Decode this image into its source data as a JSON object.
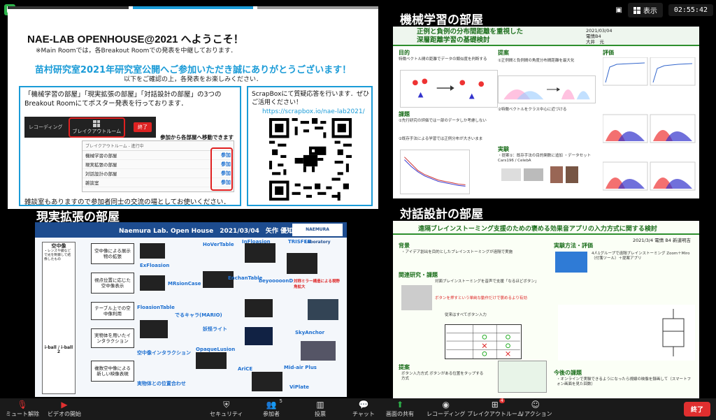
{
  "overlay": {
    "view_label": "表示",
    "clock": "02:55:42"
  },
  "main_slide": {
    "title": "NAE-LAB OPENHOUSE@2021 へようこそ！",
    "note": "※Main Roomでは，各Breakout Roomでの発表を中継しております．",
    "thanks": "苗村研究室2021年研究室公開へご参加いただき誠にありがとうございます！",
    "sub": "以下をご確認の上，各発表をお楽しみください．",
    "left_box_text": "「機械学習の部屋」「現実拡張の部屋」「対話設計の部屋」の3つのBreakout Roomにてポスター発表を行っております．",
    "zoom_recording": "レコーディング",
    "zoom_breakout": "ブレイクアウトルーム",
    "zoom_end": "終了",
    "join_caption": "参加から各部屋へ移動できます",
    "bo_panel_header": "ブレイクアウトルーム - 進行中",
    "rooms": [
      {
        "name": "機械学習の部屋",
        "join": "参加"
      },
      {
        "name": "現実拡張の部屋",
        "join": "参加"
      },
      {
        "name": "対話設計の部屋",
        "join": "参加"
      },
      {
        "name": "雑談室",
        "join": "参加"
      }
    ],
    "left_box_bottom": "雑談室もありますので参加者同士の交流の場としてお使いください．",
    "right_box_text": "ScrapBoxにて質疑応答を行います．ぜひご活用ください！",
    "url": "https://scrapbox.io/nae-lab2021/",
    "bar_colors": [
      "#333333",
      "#1a9bd7",
      "#999999"
    ]
  },
  "tiles": {
    "ml_label": "機械学習の部屋",
    "ar_label": "現実拡張の部屋",
    "dd_label": "対話設計の部屋"
  },
  "ml_poster": {
    "title_line1": "正例と負例の分布間距離を重視した",
    "title_line2": "深層距離学習の基礎検討",
    "date": "2021/03/04",
    "author_line1": "電情B4",
    "author_line2": "大井　元",
    "sec_purpose": "目的",
    "sec_proposal": "提案",
    "sec_eval": "評価",
    "sec_issue": "課題",
    "sec_exp": "実験",
    "purpose_text": "特徴ベクトル間の距離でデータの類似度を判断する",
    "issue_text": "①先行研究の評価では一部のデータしか考慮しない",
    "issue_text2": "②既存手法による学習では正例分布が大きいまま",
    "prop_text1": "①正例間と負例間の角度分布間距離を最大化",
    "prop_text2": "②特徴ベクトルをクラス中心に近づける",
    "exp_text": "・提案①：既存手法の目的関数に追加 ・データセット Cars196 / CelebA"
  },
  "ar_poster": {
    "header": "Naemura Lab. Open House　2021/03/04　矢作 優知（学府M1）",
    "logo": "NAEMURA Laboratory",
    "side_title": "空中像",
    "side_text": "・レンズや鏡などで光を制御して結像したもの",
    "side_bottom": "i-ball / i-ball 2",
    "boxes": [
      "空中像による展示物の拡張",
      "視点位置に応じた空中像表示",
      "テーブル上での空中像利用",
      "実物体を用いたインタラクション",
      "複数空中像による新しい映像表現"
    ],
    "items": [
      "HoVerTable",
      "InFloasion",
      "TRISFER",
      "ExFloasion",
      "MRsionCase",
      "EnchanTable",
      "beyooooonD",
      "対称ミラー構造による視野角拡大",
      "FloasionTable",
      "でるキャラ(MARIO)",
      "妖怪ライト",
      "SkyAnchor",
      "空中像インタラクション",
      "OpaqueLusion",
      "Mid-air Plus",
      "実物体との位置合わせ",
      "AriCE",
      "ViPlate"
    ]
  },
  "dd_poster": {
    "title": "遠隔ブレインストーミング支援のための褒める効果音アプリの入力方式に関する検討",
    "meta": "2021/3/4 電情 B4 新道明吉",
    "sec_bg": "背景",
    "sec_related": "関連研究・課題",
    "sec_prop": "提案",
    "sec_exp": "実験方法・評価",
    "sec_future": "今後の課題",
    "bg_text": "・アイデア創出を目的としたブレインストーミングが遠隔で実施",
    "related_text": "対面ブレインストーミングを音声で支援「なるほどボタン」",
    "related_red": "ボタンを押すという単純な動作だけで褒めるより有効",
    "prop_text": "ボタン入力方式 ボタンがある位置をタップする方式",
    "exp_text": "4人1グループで遠隔ブレインストーミング Zoom＋Miro（付箋ツール）＋提案アプリ",
    "future_text": "・オンラインで実験できるようになったら視線の映像を録画して（スマートフォン画面を見た回数）",
    "table_head": "従来はすべてボタン入力"
  },
  "toolbar": {
    "mute": "ミュート解除",
    "video": "ビデオの開始",
    "security": "セキュリティ",
    "participants": "参加者",
    "participants_count": "5",
    "polls": "投票",
    "chat": "チャット",
    "share": "画面の共有",
    "recording": "レコーディング",
    "breakout": "ブレイクアウトルーム",
    "breakout_badge": "4",
    "reactions": "リアクション",
    "end": "終了"
  }
}
